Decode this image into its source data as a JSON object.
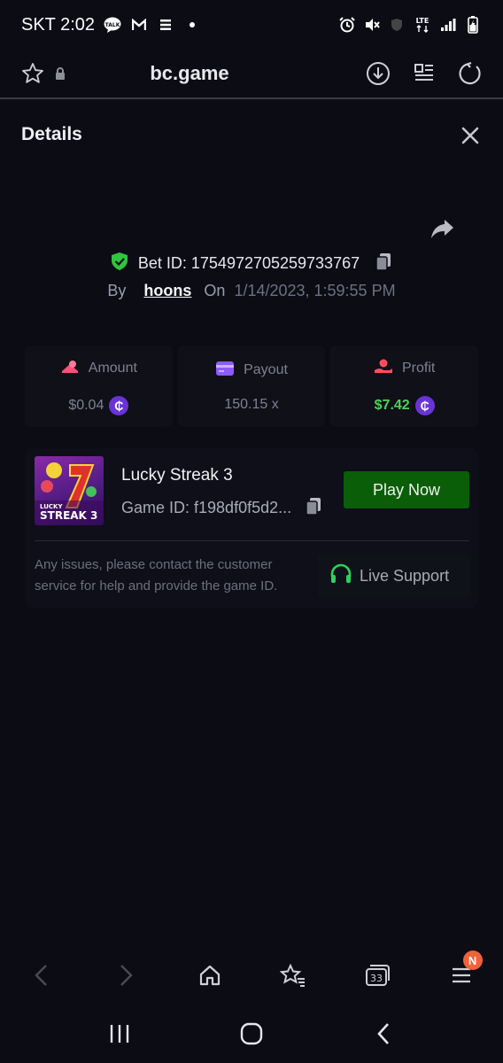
{
  "status_bar": {
    "carrier_time": "SKT 2:02",
    "icons_left": [
      "talk-icon",
      "gmail-icon",
      "menu-icon",
      "dot-icon"
    ],
    "network": "LTE",
    "icons_right": [
      "alarm-icon",
      "mute-icon",
      "shield-icon",
      "lte-icon",
      "signal-icon",
      "battery-icon"
    ]
  },
  "browser": {
    "url": "bc.game"
  },
  "panel": {
    "title": "Details",
    "bet_id_text": "Bet ID: 1754972705259733767",
    "by_label": "By",
    "username": "hoons",
    "on_label": "On",
    "date": "1/14/2023, 1:59:55 PM"
  },
  "stats": [
    {
      "label": "Amount",
      "value": "$0.04",
      "has_coin": true,
      "color": "#7f8190"
    },
    {
      "label": "Payout",
      "value": "150.15 x",
      "has_coin": false,
      "color": "#7f8190"
    },
    {
      "label": "Profit",
      "value": "$7.42",
      "has_coin": true,
      "color": "#4fd05a"
    }
  ],
  "game": {
    "name": "Lucky Streak 3",
    "game_id": "Game ID: f198df0f5d2...",
    "play_label": "Play Now",
    "thumb_title_top": "LUCKY",
    "thumb_title_bottom": "STREAK 3",
    "issue_text": "Any issues, please contact the customer service for help and provide the game ID.",
    "support_label": "Live Support"
  },
  "bottom_nav": {
    "tabs_count": "33",
    "badge": "N"
  },
  "colors": {
    "background": "#0b0c14",
    "play_button": "#0a5e08",
    "profit_green": "#4fd05a",
    "coin_purple": "#6a33d6",
    "badge_orange": "#f0623a"
  }
}
